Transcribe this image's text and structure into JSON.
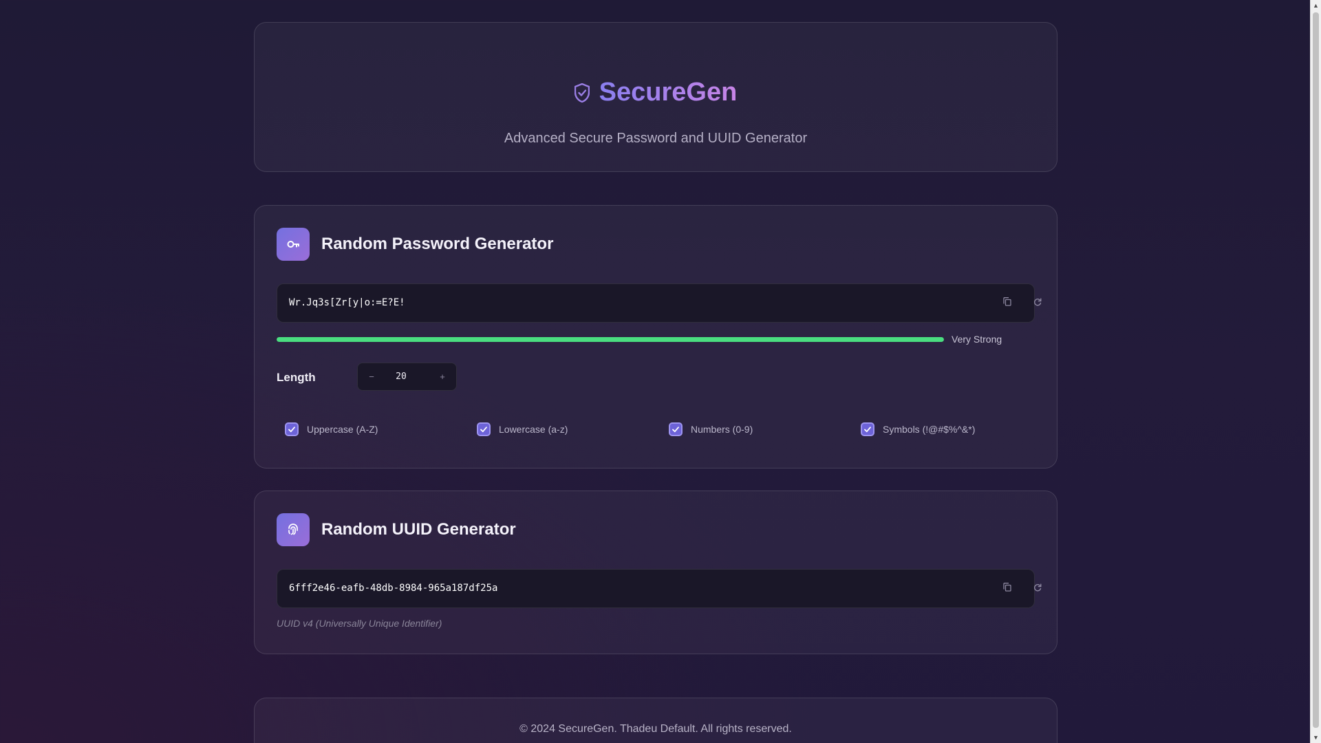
{
  "header": {
    "brand_icon": "shield-icon",
    "title": "SecureGen",
    "subtitle": "Advanced Secure Password and UUID Generator"
  },
  "password_section": {
    "icon": "key-icon",
    "title": "Random Password Generator",
    "value": "Wr.Jq3s[Zr[y|o:=E?E!",
    "strength": {
      "label": "Very Strong",
      "fraction": 1.0,
      "color": "#4ade80"
    },
    "length": {
      "label": "Length",
      "value": "20",
      "minus": "−",
      "plus": "+"
    },
    "options": [
      {
        "label": "Uppercase (A-Z)",
        "checked": true
      },
      {
        "label": "Lowercase (a-z)",
        "checked": true
      },
      {
        "label": "Numbers (0-9)",
        "checked": true
      },
      {
        "label": "Symbols (!@#$%^&*)",
        "checked": true
      }
    ]
  },
  "uuid_section": {
    "icon": "fingerprint-icon",
    "title": "Random UUID Generator",
    "value": "6fff2e46-eafb-48db-8984-965a187df25a",
    "note": "UUID v4 (Universally Unique Identifier)"
  },
  "footer": {
    "text": "© 2024 SecureGen. Thadeu Default. All rights reserved."
  },
  "colors": {
    "accent": "#7470e0",
    "accent_end": "#9a6ed8",
    "background": "#211b38",
    "success": "#4ade80"
  }
}
